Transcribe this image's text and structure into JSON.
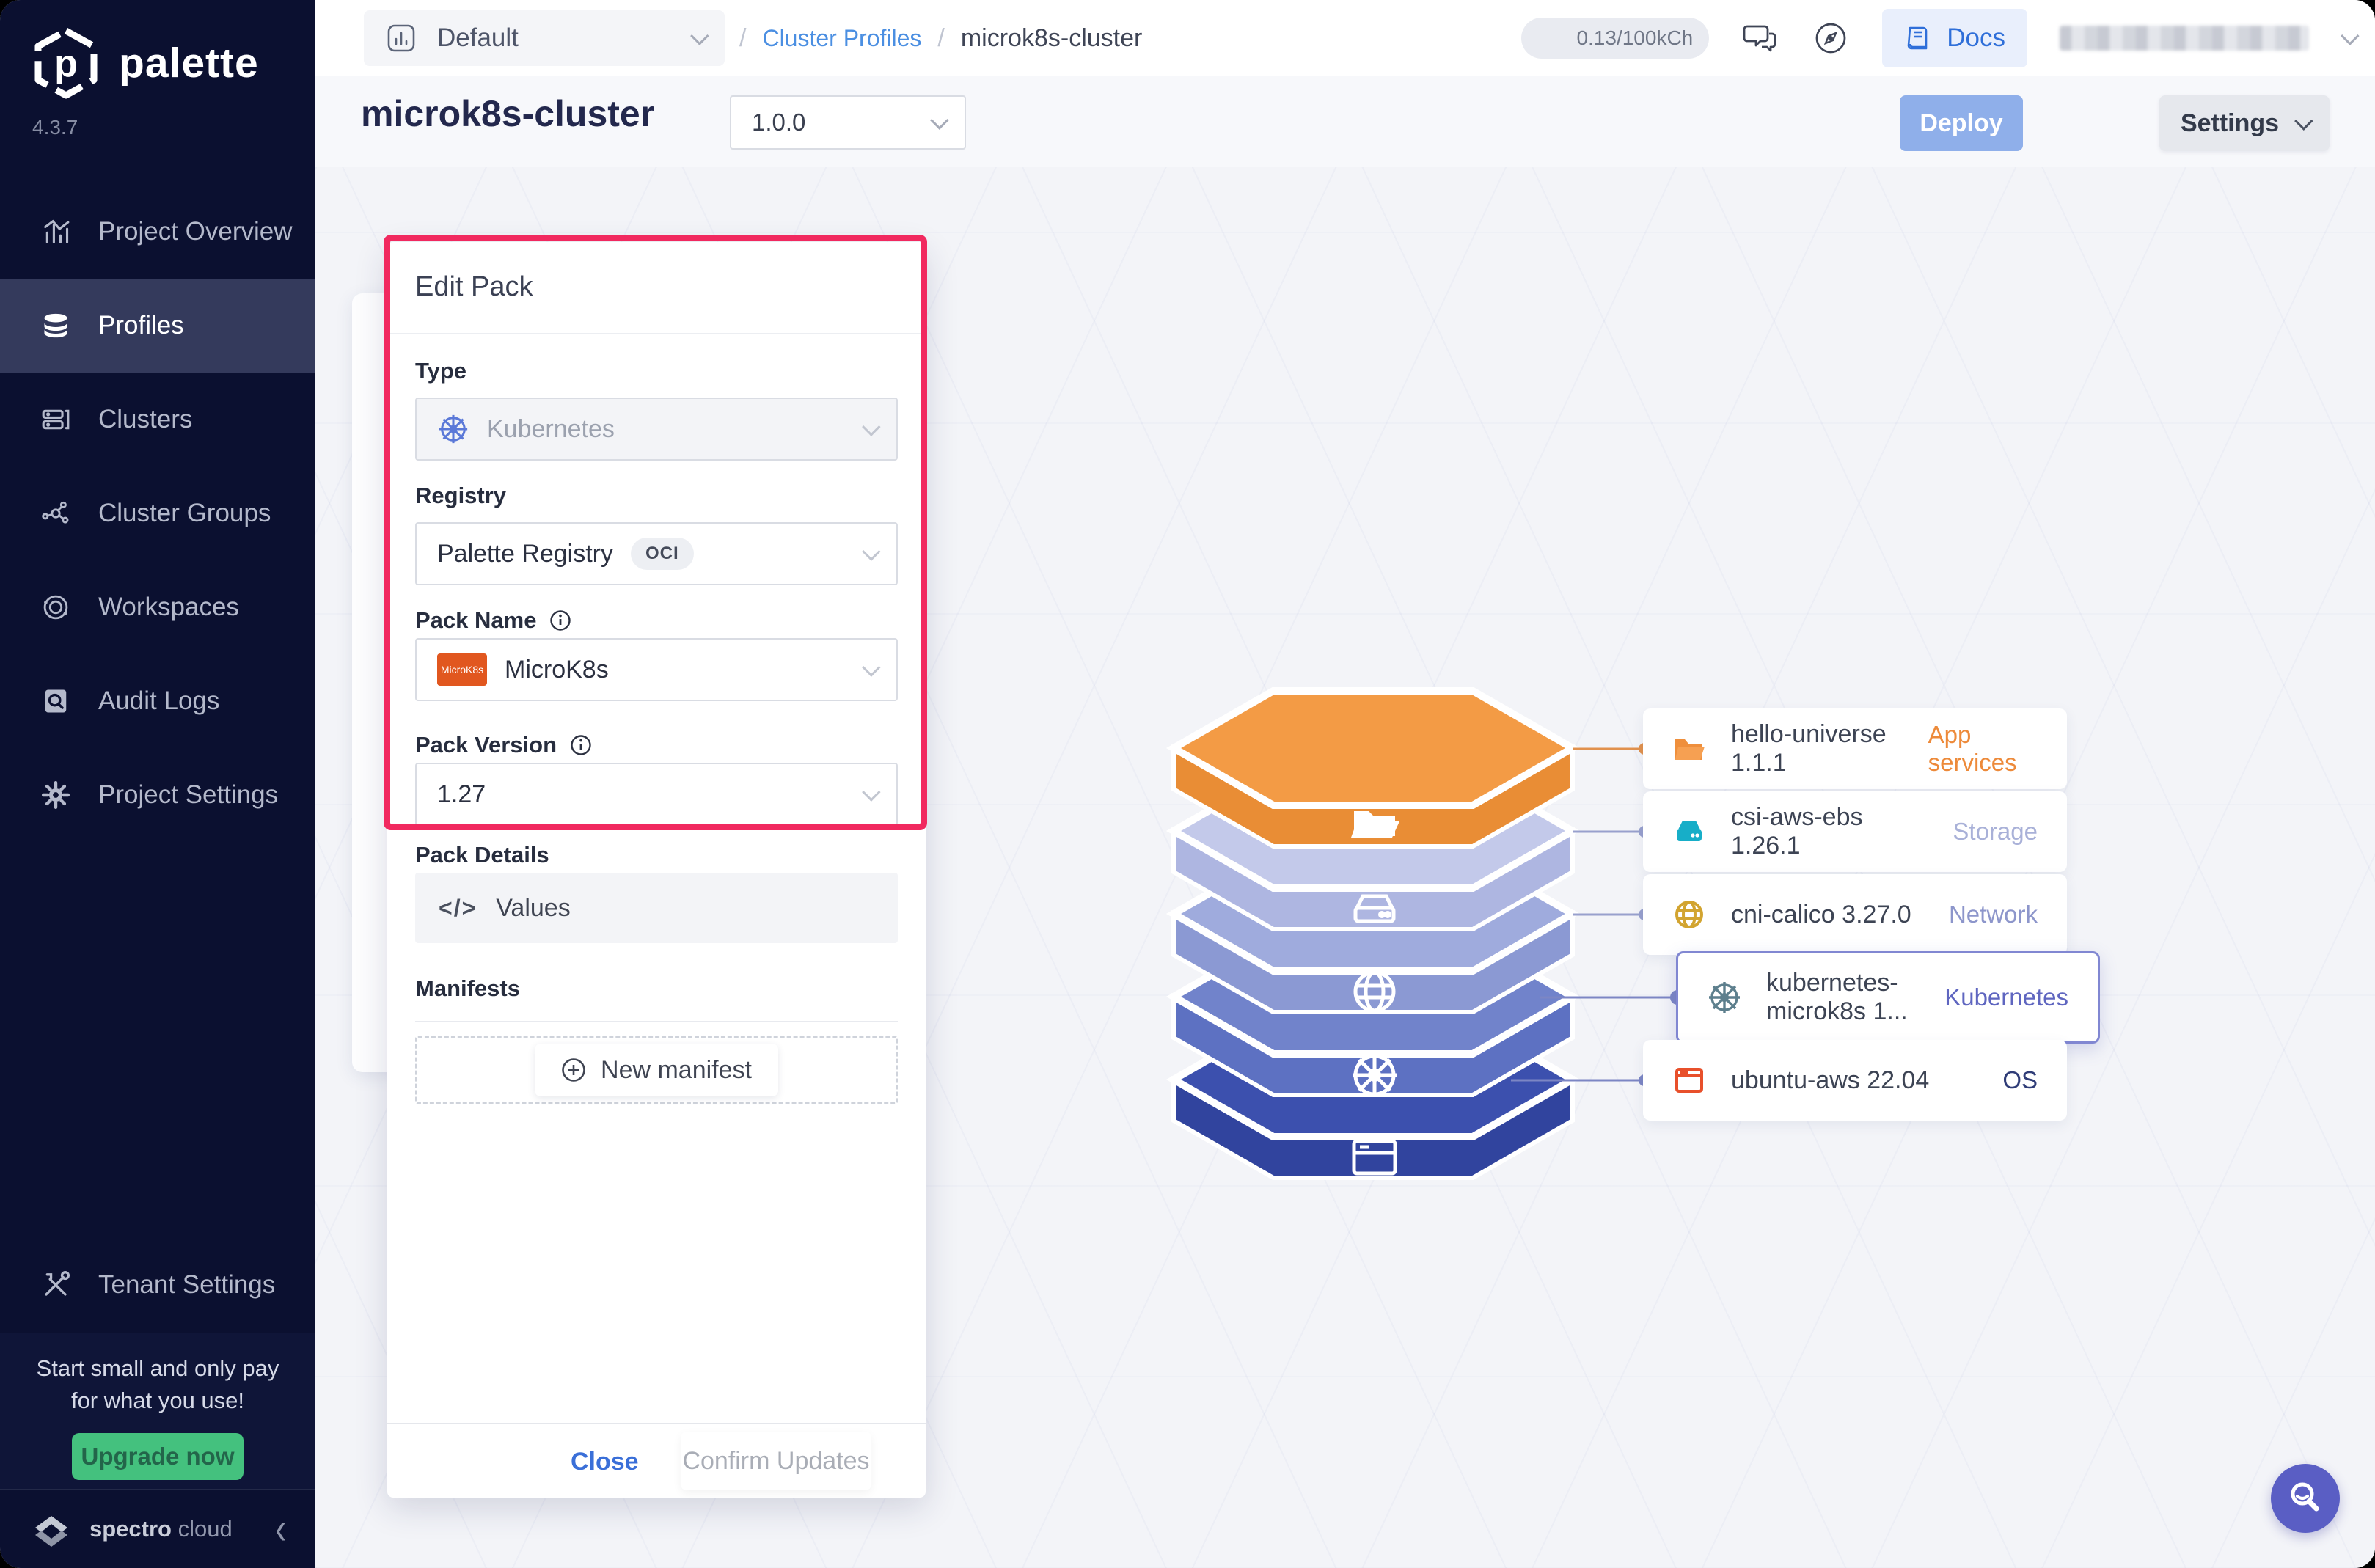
{
  "app": {
    "brand": "palette",
    "version": "4.3.7"
  },
  "sidebar": {
    "items": [
      {
        "label": "Project Overview"
      },
      {
        "label": "Profiles"
      },
      {
        "label": "Clusters"
      },
      {
        "label": "Cluster Groups"
      },
      {
        "label": "Workspaces"
      },
      {
        "label": "Audit Logs"
      },
      {
        "label": "Project Settings"
      }
    ],
    "tenant_settings": "Tenant Settings",
    "promo": {
      "line1": "Start small and only pay",
      "line2": "for what you use!",
      "button": "Upgrade now"
    },
    "footer": {
      "brand_bold": "spectro",
      "brand_light": " cloud",
      "collapse_icon": "‹"
    }
  },
  "topbar": {
    "project_selector": "Default",
    "breadcrumb": {
      "sep1": "/",
      "link": "Cluster Profiles",
      "sep2": "/",
      "current": "microk8s-cluster"
    },
    "usage": "0.13/100kCh",
    "docs": "Docs"
  },
  "header": {
    "title": "microk8s-cluster",
    "version": "1.0.0",
    "deploy": "Deploy",
    "settings": "Settings"
  },
  "edit_pack": {
    "title": "Edit Pack",
    "type_label": "Type",
    "type_value": "Kubernetes",
    "registry_label": "Registry",
    "registry_value": "Palette Registry",
    "registry_badge": "OCI",
    "pack_name_label": "Pack Name",
    "pack_logo_text": "MicroK8s",
    "pack_name_value": "MicroK8s",
    "pack_version_label": "Pack Version",
    "pack_version_value": "1.27",
    "details_label": "Pack Details",
    "values_icon": "</>",
    "values_label": "Values",
    "manifests_label": "Manifests",
    "new_manifest": "New manifest",
    "close": "Close",
    "confirm": "Confirm Updates"
  },
  "stack": {
    "cards": [
      {
        "name": "hello-universe 1.1.1",
        "type": "App services",
        "type_color": "#ed8a3a"
      },
      {
        "name": "csi-aws-ebs 1.26.1",
        "type": "Storage",
        "type_color": "#a9b1d8"
      },
      {
        "name": "cni-calico 3.27.0",
        "type": "Network",
        "type_color": "#8d96cb"
      },
      {
        "name": "kubernetes-microk8s 1...",
        "type": "Kubernetes",
        "type_color": "#5f66c0"
      },
      {
        "name": "ubuntu-aws 22.04",
        "type": "OS",
        "type_color": "#2f3c77"
      }
    ]
  }
}
